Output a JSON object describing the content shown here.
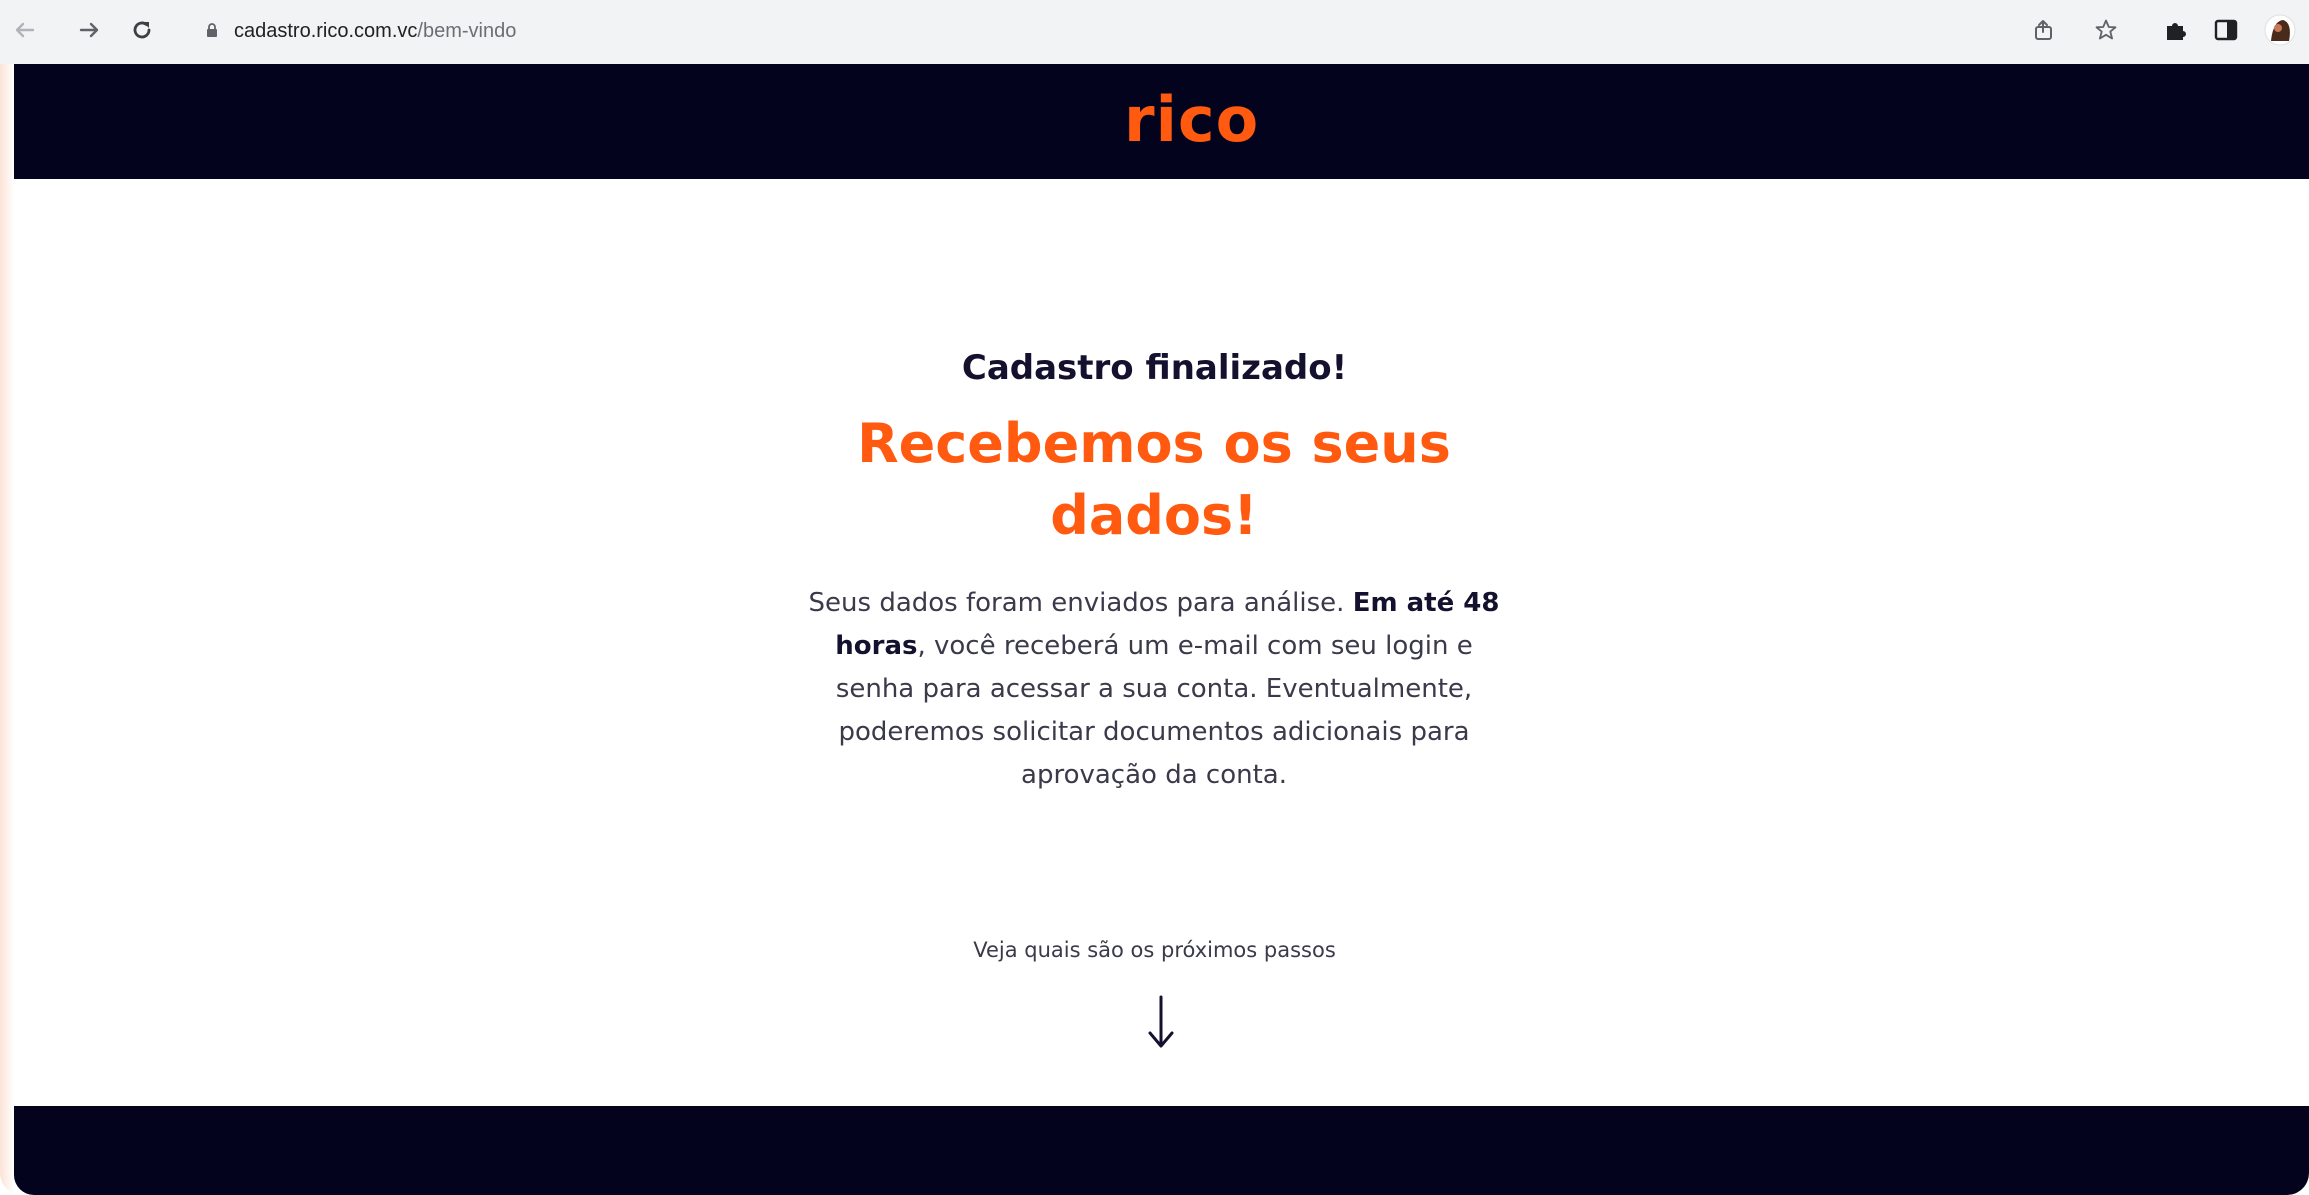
{
  "browser": {
    "url_host": "cadastro.rico.com.vc",
    "url_path": "/bem-vindo"
  },
  "header": {
    "logo_text": "rico"
  },
  "main": {
    "kicker": "Cadastro finalizado!",
    "headline_line1": "Recebemos os seus",
    "headline_line2": "dados!",
    "body": {
      "part1": "Seus dados foram enviados para análise. ",
      "bold": "Em até 48 horas",
      "part2": ", você receberá um e-mail com seu login e senha para acessar a sua conta. Eventualmente, poderemos solicitar documentos adicionais para aprovação da conta."
    },
    "next_steps": "Veja quais são os próximos passos"
  },
  "icons": {
    "back": "back-arrow-icon",
    "forward": "forward-arrow-icon",
    "reload": "reload-icon",
    "lock": "lock-icon",
    "share": "share-icon",
    "bookmark": "star-icon",
    "extensions": "puzzle-icon",
    "sidepanel": "sidepanel-icon",
    "profile": "profile-avatar-icon",
    "scroll": "arrow-down-icon"
  },
  "colors": {
    "brand_orange": "#ff5a0f",
    "brand_navy": "#04031d"
  }
}
